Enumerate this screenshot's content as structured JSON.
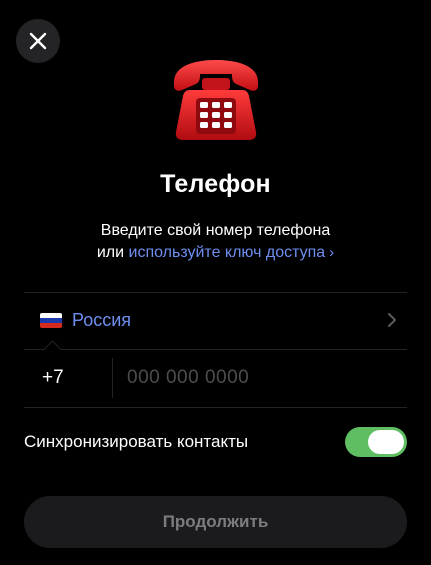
{
  "header": {
    "close_icon": "close-icon"
  },
  "hero": {
    "icon": "telephone-icon",
    "accent_color": "#e0161b"
  },
  "title": "Телефон",
  "subtitle": {
    "line1": "Введите свой номер телефона",
    "prefix": "или",
    "link_label": "используйте ключ доступа",
    "link_chevron": "›"
  },
  "country": {
    "flag_icon": "russia-flag-icon",
    "flag_colors": [
      "#ffffff",
      "#1c3aa9",
      "#d52b1e"
    ],
    "name": "Россия",
    "chevron_icon": "chevron-right-icon"
  },
  "phone": {
    "dial_code": "+7",
    "value": "",
    "placeholder": "000 000 0000"
  },
  "sync_contacts": {
    "label": "Синхронизировать контакты",
    "enabled": true,
    "on_color": "#5fbd62"
  },
  "continue_button": {
    "label": "Продолжить"
  },
  "colors": {
    "background": "#000000",
    "link": "#6e8ff0",
    "button_bg": "#1b1b1d",
    "button_text": "#7c7c80"
  }
}
